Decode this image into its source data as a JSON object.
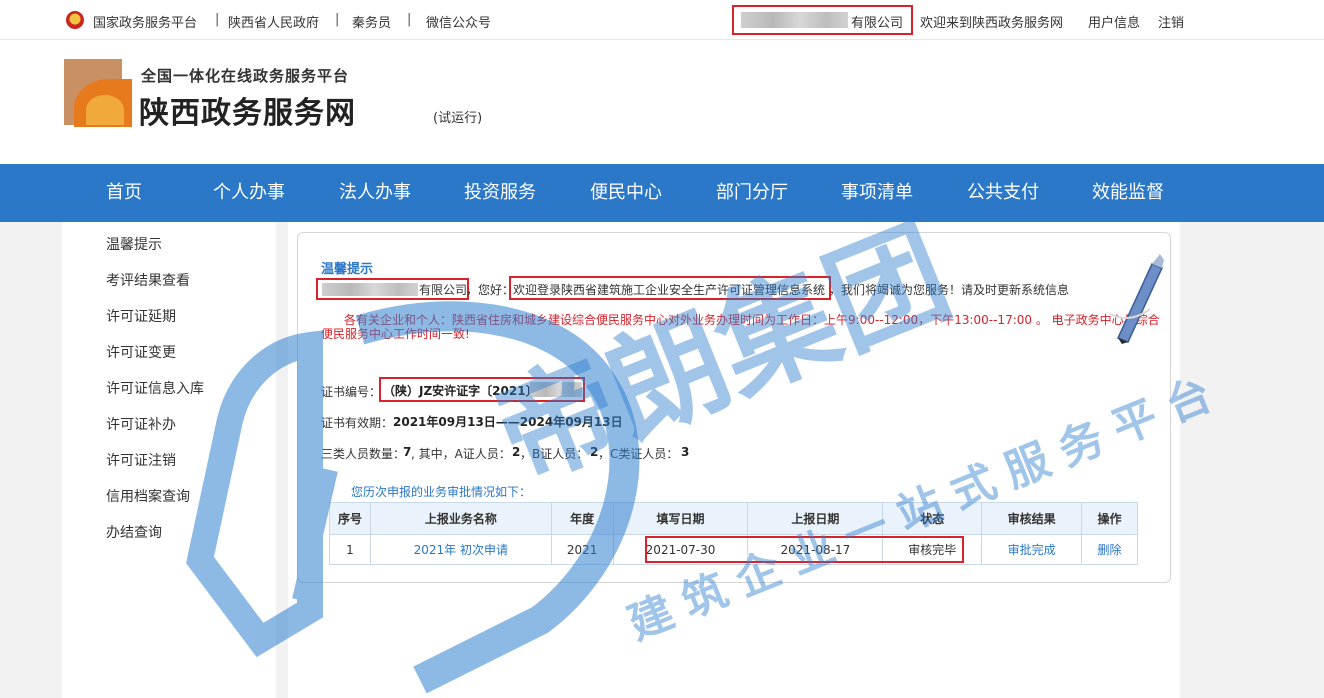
{
  "topbar": {
    "national_platform": "国家政务服务平台",
    "provincial_gov": "陕西省人民政府",
    "qinfuyuan": "秦务员",
    "wechat": "微信公众号",
    "company_suffix": "有限公司",
    "welcome": "欢迎来到陕西政务服务网",
    "user_info": "用户信息",
    "logout": "注销",
    "sep": "|"
  },
  "header": {
    "subtitle": "全国一体化在线政务服务平台",
    "title": "陕西政务服务网",
    "trial": "(试运行)"
  },
  "nav": {
    "items": [
      "首页",
      "个人办事",
      "法人办事",
      "投资服务",
      "便民中心",
      "部门分厅",
      "事项清单",
      "公共支付",
      "效能监督"
    ]
  },
  "sidebar": {
    "items": [
      "温馨提示",
      "考评结果查看",
      "许可证延期",
      "许可证变更",
      "许可证信息入库",
      "许可证补办",
      "许可证注销",
      "信用档案查询",
      "办结查询"
    ]
  },
  "main": {
    "tip_title": "温馨提示",
    "company_suffix": "有限公司",
    "hello": "，您好：",
    "welcome_system": "欢迎登录陕西省建筑施工企业安全生产许可证管理信息系统",
    "greeting_tail": "，我们将竭诚为您服务！请及时更新系统信息",
    "notice_line1": "各有关企业和个人：陕西省住房和城乡建设综合便民服务中心对外业务办理时间为工作日：上午9:00--12:00，下午13:00--17:00 。 电子政务中心与综合",
    "notice_line2": "便民服务中心工作时间一致!",
    "cert_no_label": "证书编号：",
    "cert_no_value": "（陕）JZ安许证字〔2021〕",
    "validity_label": "证书有效期：",
    "validity_value": "2021年09月13日——2024年09月13日",
    "staff_label": "三类人员数量：",
    "staff_total": "7",
    "staff_mid": ", 其中，A证人员：",
    "staff_a": "2",
    "staff_b_label": "，B证人员：",
    "staff_b": "2",
    "staff_c_label": "，C类证人员：",
    "staff_c": "3",
    "history_title": "您历次申报的业务审批情况如下："
  },
  "table": {
    "headers": [
      "序号",
      "上报业务名称",
      "年度",
      "填写日期",
      "上报日期",
      "状态",
      "审核结果",
      "操作"
    ],
    "rows": [
      {
        "no": "1",
        "name": "2021年 初次申请",
        "year": "2021",
        "fill_date": "2021-07-30",
        "report_date": "2021-08-17",
        "status": "审核完毕",
        "result": "审批完成",
        "action": "删除"
      }
    ]
  },
  "watermark": {
    "brand": "帝朗集团",
    "slogan": "建筑企业一站式服务平台"
  },
  "colors": {
    "nav_blue": "#2b78c8",
    "highlight_red": "#d9222a",
    "notice_red": "#d9222a",
    "watermark_blue": "#2f7fcf"
  }
}
